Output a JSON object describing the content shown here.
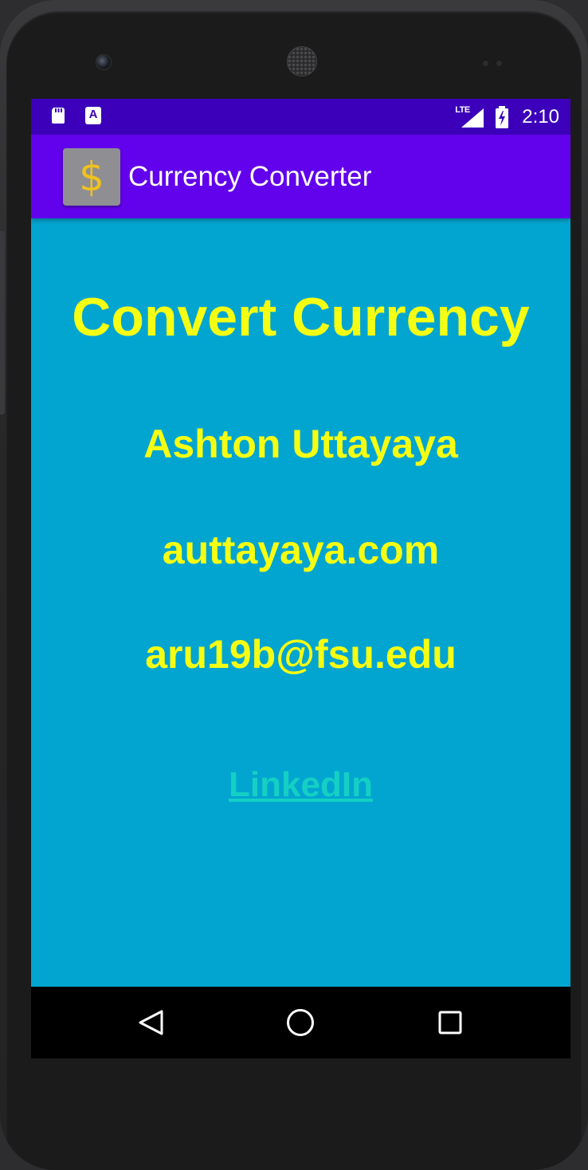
{
  "status_bar": {
    "time": "2:10",
    "network": "LTE",
    "icons": [
      "sd-card-icon",
      "a-notification-icon",
      "lte-signal-icon",
      "battery-charging-icon"
    ],
    "a_icon_letter": "A"
  },
  "app_bar": {
    "title": "Currency Converter",
    "icon_glyph": "$",
    "icon": "dollar-icon"
  },
  "main": {
    "heading": "Convert Currency",
    "name": "Ashton Uttayaya",
    "website": "auttayaya.com",
    "email": "aru19b@fsu.edu",
    "link_label": "LinkedIn"
  },
  "nav_bar": {
    "icons": [
      "back-icon",
      "home-icon",
      "recents-icon"
    ]
  },
  "colors": {
    "status_bar": "#3c00ba",
    "app_bar": "#6201ec",
    "background": "#02a5d0",
    "heading_text": "#f5ff14",
    "link_text": "#14d0c4",
    "app_icon_bg": "#8f8f93",
    "app_icon_glyph": "#f1c21b"
  }
}
